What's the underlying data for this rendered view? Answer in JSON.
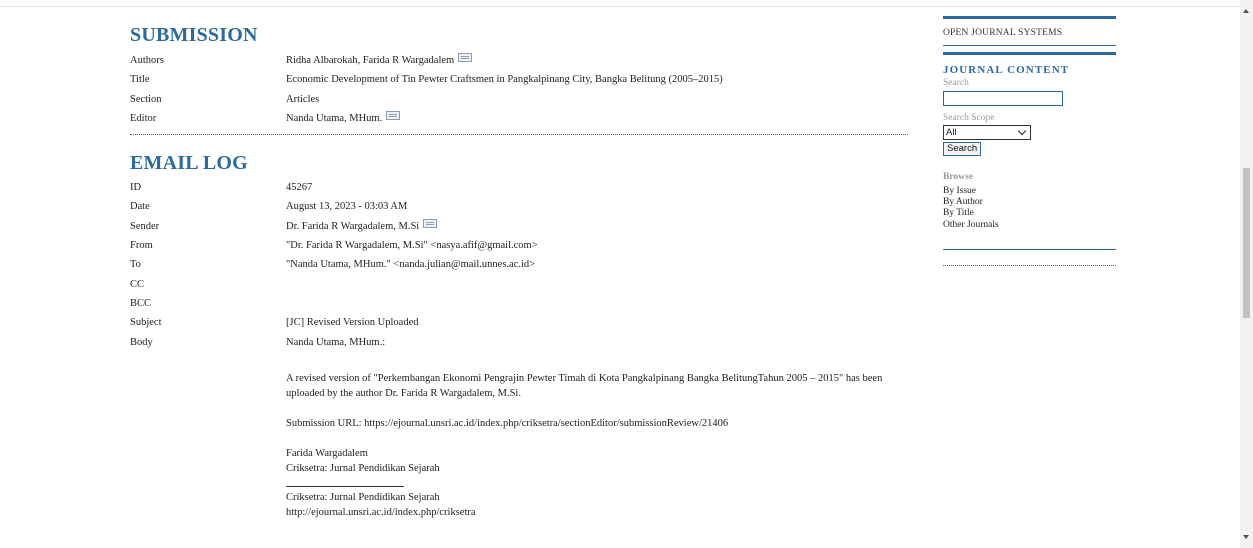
{
  "submission": {
    "heading": "SUBMISSION",
    "rows": [
      {
        "label": "Authors",
        "value": "Ridha Albarokah, Farida R Wargadalem",
        "mail": true
      },
      {
        "label": "Title",
        "value": "Economic Development of Tin Pewter Craftsmen in Pangkalpinang City, Bangka Belitung (2005–2015)",
        "mail": false
      },
      {
        "label": "Section",
        "value": "Articles",
        "mail": false
      },
      {
        "label": "Editor",
        "value": "Nanda Utama, MHum.",
        "mail": true
      }
    ]
  },
  "email_log": {
    "heading": "EMAIL LOG",
    "rows": [
      {
        "label": "ID",
        "value": "45267",
        "mail": false
      },
      {
        "label": "Date",
        "value": "August 13, 2023 - 03:03 AM",
        "mail": false
      },
      {
        "label": "Sender",
        "value": "Dr. Farida R Wargadalem, M.Si",
        "mail": true
      },
      {
        "label": "From",
        "value": "\"Dr. Farida R Wargadalem, M.Si\" <nasya.afif@gmail.com>",
        "mail": false
      },
      {
        "label": "To",
        "value": "\"Nanda Utama, MHum.\" <nanda.julian@mail.unnes.ac.id>",
        "mail": false
      },
      {
        "label": "CC",
        "value": "",
        "mail": false
      },
      {
        "label": "BCC",
        "value": "",
        "mail": false
      },
      {
        "label": "Subject",
        "value": "[JC] Revised Version Uploaded",
        "mail": false
      },
      {
        "label": "Body",
        "value": "Nanda Utama, MHum.:",
        "mail": false
      }
    ],
    "body": {
      "paragraph1": "A revised version of \"Perkembangan Ekonomi Pengrajin Pewter Timah di Kota Pangkalpinang Bangka BelitungTahun 2005 – 2015\" has been uploaded by the author Dr. Farida R Wargadalem, M.Si.",
      "submission_url": "Submission URL: https://ejournal.unsri.ac.id/index.php/criksetra/sectionEditor/submissionReview/21406",
      "signature_name": "Farida Wargadalem",
      "signature_journal": "Criksetra: Jurnal Pendidikan Sejarah",
      "footer_journal": "Criksetra: Jurnal Pendidikan Sejarah",
      "footer_url": "http://ejournal.unsri.ac.id/index.php/criksetra"
    }
  },
  "sidebar": {
    "ojs_link": "OPEN JOURNAL SYSTEMS",
    "journal_content_title": "JOURNAL CONTENT",
    "search_label": "Search",
    "search_value": "",
    "scope_label": "Search Scope",
    "scope_selected": "All",
    "search_button": "Search",
    "browse_title": "Browse",
    "browse_links": [
      "By Issue",
      "By Author",
      "By Title",
      "Other Journals"
    ]
  },
  "icons": {
    "mail": "envelope-icon"
  },
  "colors": {
    "heading": "#2a6aa0",
    "separator": "#b04040"
  }
}
